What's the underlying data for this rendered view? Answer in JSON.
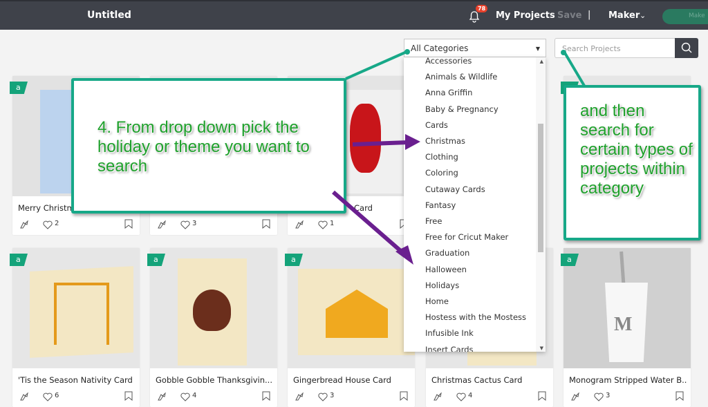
{
  "header": {
    "title": "Untitled",
    "notification_count": "78",
    "my_projects": "My Projects",
    "save": "Save",
    "separator": "|",
    "machine": "Maker",
    "make_button": "Make"
  },
  "filters": {
    "category_selected": "All Categories",
    "search_placeholder": "Search Projects"
  },
  "dropdown": {
    "options": [
      "Accessories",
      "Animals & Wildlife",
      "Anna Griffin",
      "Baby & Pregnancy",
      "Cards",
      "Christmas",
      "Clothing",
      "Coloring",
      "Cutaway Cards",
      "Fantasy",
      "Free",
      "Free for Cricut Maker",
      "Graduation",
      "Halloween",
      "Holidays",
      "Home",
      "Hostess with the Mostess",
      "Infusible Ink",
      "Insert Cards"
    ]
  },
  "cards": [
    {
      "name": "Merry Christmas",
      "likes": "2",
      "badge": "a"
    },
    {
      "name": "",
      "likes": "3",
      "badge": "a"
    },
    {
      "name": "Card",
      "likes": "1",
      "badge": "a"
    },
    {
      "name": "",
      "likes": "",
      "badge": "a"
    },
    {
      "name": "",
      "likes": "",
      "badge": "a"
    },
    {
      "name": "'Tis the Season Nativity Card",
      "likes": "6",
      "badge": "a"
    },
    {
      "name": "Gobble Gobble Thanksgivin...",
      "likes": "4",
      "badge": "a"
    },
    {
      "name": "Gingerbread House Card",
      "likes": "3",
      "badge": "a"
    },
    {
      "name": "Christmas Cactus Card",
      "likes": "4",
      "badge": "a"
    },
    {
      "name": "Monogram Stripped Water B...",
      "likes": "3",
      "badge": "a"
    }
  ],
  "annotations": {
    "callout_left": "4. From drop down pick the holiday or theme you want to search",
    "callout_right": "and then search for certain types of projects within category"
  },
  "colors": {
    "topbar": "#3f424a",
    "accent_green": "#14a37a",
    "callout_border": "#17a888",
    "callout_text": "#1fa12c",
    "arrow_purple": "#6a1f8f",
    "badge_red": "#e8412c"
  }
}
